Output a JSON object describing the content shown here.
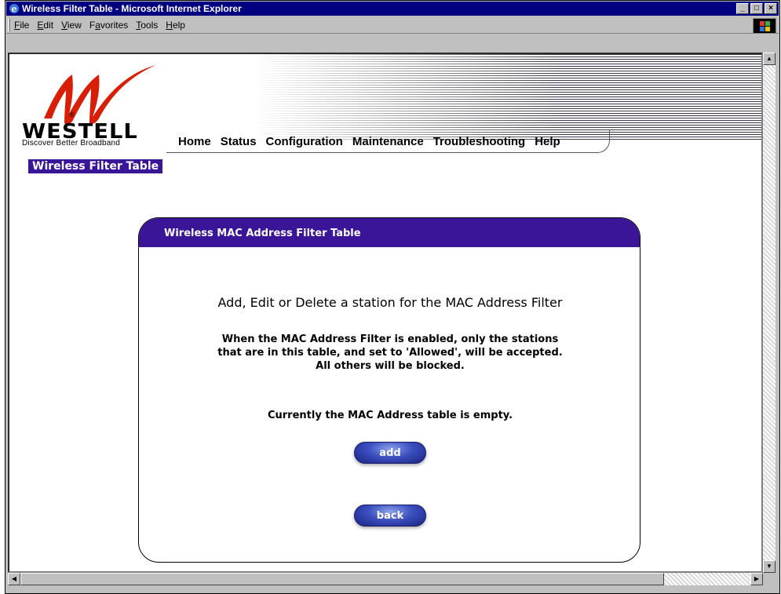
{
  "window": {
    "title": "Wireless Filter Table - Microsoft Internet Explorer",
    "controls": [
      "_",
      "□",
      "×"
    ]
  },
  "menubar": {
    "items": [
      {
        "label": "File",
        "ul": "F",
        "rest": "ile"
      },
      {
        "label": "Edit",
        "ul": "E",
        "rest": "dit"
      },
      {
        "label": "View",
        "ul": "V",
        "rest": "iew"
      },
      {
        "label": "Favorites",
        "pre": "F",
        "ul": "a",
        "rest": "vorites"
      },
      {
        "label": "Tools",
        "ul": "T",
        "rest": "ools"
      },
      {
        "label": "Help",
        "ul": "H",
        "rest": "elp"
      }
    ]
  },
  "brand": {
    "name": "WESTELL",
    "tagline": "Discover  Better  Broadband",
    "registered": "®"
  },
  "nav": {
    "home": "Home",
    "status": "Status",
    "configuration": "Configuration",
    "maintenance": "Maintenance",
    "troubleshooting": "Troubleshooting",
    "help": "Help"
  },
  "page": {
    "label": "Wireless Filter Table"
  },
  "panel": {
    "heading": "Wireless MAC Address Filter Table",
    "title": "Add, Edit or Delete a station for the MAC Address Filter",
    "desc_line1": "When the MAC Address Filter is enabled, only the stations",
    "desc_line2": "that are in this table, and set to 'Allowed', will be accepted.",
    "desc_line3": "All others will be blocked.",
    "empty_message": "Currently the MAC Address table is empty.",
    "add_label": "add",
    "back_label": "back"
  },
  "colors": {
    "accent": "#3b1597",
    "titlebar": "#000080"
  }
}
